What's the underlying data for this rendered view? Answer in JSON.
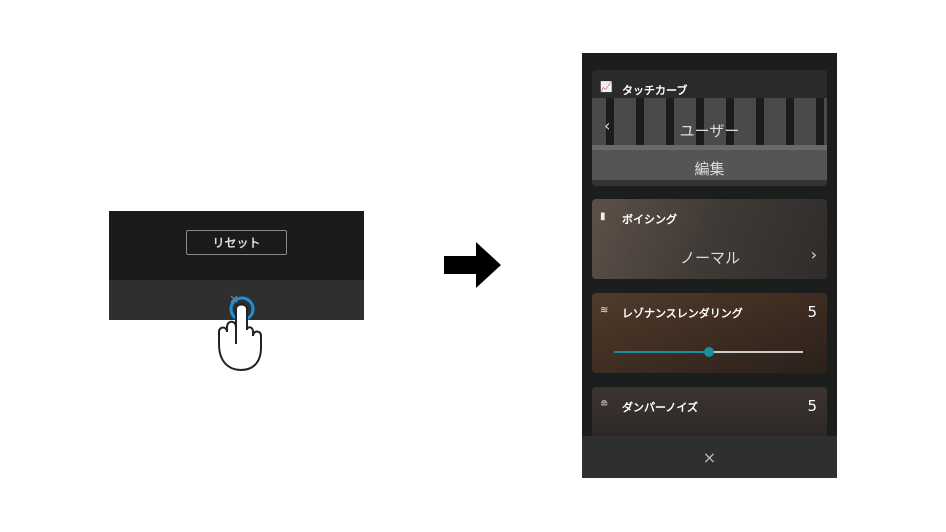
{
  "before": {
    "reset_label": "リセット",
    "close_icon": "close-icon"
  },
  "after": {
    "touch_curve": {
      "title": "タッチカーブ",
      "value": "ユーザー",
      "edit": "編集",
      "prev": "‹"
    },
    "voicing": {
      "title": "ボイシング",
      "value": "ノーマル",
      "next": "›"
    },
    "resonance": {
      "title": "レゾナンスレンダリング",
      "value": "5",
      "slider_fraction": 0.5
    },
    "damper": {
      "title": "ダンパーノイズ",
      "value": "5"
    },
    "close": "×"
  },
  "colors": {
    "accent": "#1a8fa0"
  }
}
